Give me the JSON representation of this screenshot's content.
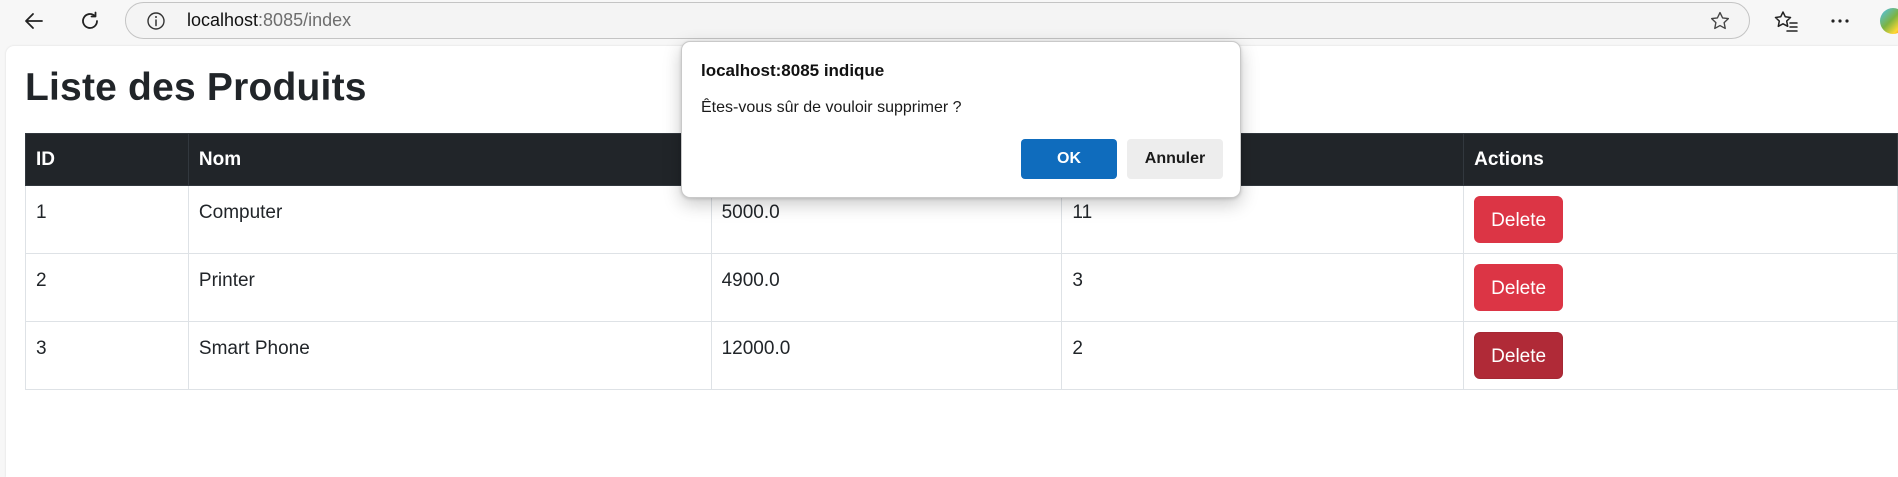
{
  "browser": {
    "url_host": "localhost",
    "url_rest": ":8085/index"
  },
  "page": {
    "title": "Liste des Produits",
    "table": {
      "headers": [
        "ID",
        "Nom",
        "",
        "",
        "Actions"
      ],
      "rows": [
        {
          "id": "1",
          "nom": "Computer",
          "prix": "5000.0",
          "quantite": "11",
          "action": "Delete"
        },
        {
          "id": "2",
          "nom": "Printer",
          "prix": "4900.0",
          "quantite": "3",
          "action": "Delete"
        },
        {
          "id": "3",
          "nom": "Smart Phone",
          "prix": "12000.0",
          "quantite": "2",
          "action": "Delete"
        }
      ]
    }
  },
  "dialog": {
    "title": "localhost:8085 indique",
    "message": "Êtes-vous sûr de vouloir supprimer ?",
    "ok_label": "OK",
    "cancel_label": "Annuler"
  },
  "colors": {
    "table_header_bg": "#212529",
    "delete_button": "#dc3545",
    "delete_button_hover": "#b02a37",
    "dialog_ok": "#0f6cbd"
  },
  "icons": [
    "back-arrow-icon",
    "refresh-icon",
    "info-icon",
    "star-icon",
    "favorites-icon",
    "more-icon",
    "copilot-icon"
  ]
}
